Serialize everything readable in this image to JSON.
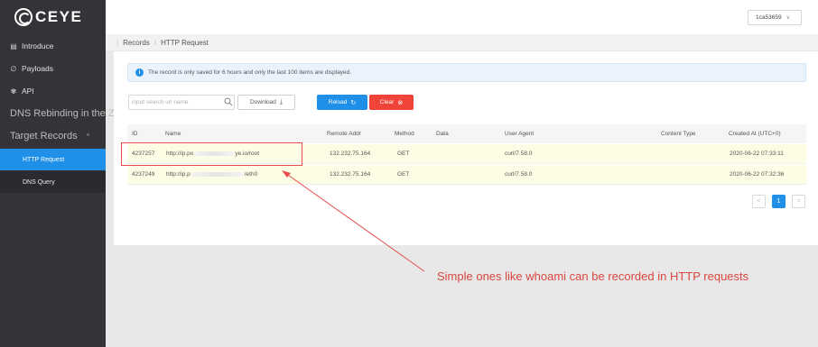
{
  "app": {
    "logo_text": "CEYE"
  },
  "user": {
    "id": "1ca53659",
    "caret": "∨"
  },
  "sidebar": {
    "introduce": "Introduce",
    "payloads": "Payloads",
    "api": "API",
    "dns_rebinding": "DNS Rebinding in the Zone",
    "target_records": "Target Records",
    "target_chevron": "^",
    "http_request": "HTTP Request",
    "dns_query": "DNS Query"
  },
  "breadcrumb": {
    "sep0": "|",
    "records": "Records",
    "sep": "/",
    "current": "HTTP Request"
  },
  "notice": {
    "text": "The record is only saved for 6 hours and only the last 100 items are displayed."
  },
  "toolbar": {
    "search_placeholder": "input search url name",
    "download": "Download",
    "reload": "Reload",
    "clear": "Clear"
  },
  "table": {
    "headers": [
      "ID",
      "Name",
      "Remote Addr",
      "Method",
      "Data",
      "User Agent",
      "Content Type",
      "Created At (UTC+0)"
    ],
    "rows": [
      {
        "id": "4237257",
        "name_pre": "http://ip.po",
        "name_post": "ye.io/root",
        "remote": "132.232.75.164",
        "method": "GET",
        "data": "",
        "ua": "curl/7.58.0",
        "ctype": "",
        "created": "2020-06-22 07:33:11"
      },
      {
        "id": "4237249",
        "name_pre": "http://ip.p",
        "name_post": "/eth0",
        "remote": "132.232.75.164",
        "method": "GET",
        "data": "",
        "ua": "curl/7.58.0",
        "ctype": "",
        "created": "2020-06-22 07:32:36"
      }
    ]
  },
  "pagination": {
    "prev": "<",
    "page": "1",
    "next": ">"
  },
  "annotation": {
    "text": "Simple ones like whoami can be recorded in HTTP requests"
  },
  "colors": {
    "accent": "#1f8fe8",
    "danger": "#f0433a",
    "annotation": "#d9463f",
    "sidebar": "#323437"
  }
}
